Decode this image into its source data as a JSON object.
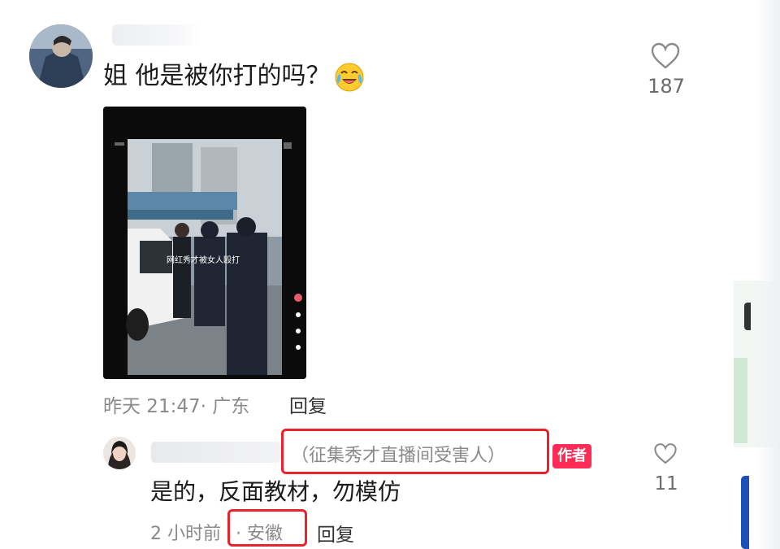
{
  "top_comment": {
    "text": "姐 他是被你打的吗？",
    "emoji": "crying-laughing-face-icon",
    "likes": "187",
    "time": "昨天 21:47",
    "location": "· 广东",
    "reply_label": "回复",
    "video_overlay_text": "网红秀才被女人殴打"
  },
  "reply_comment": {
    "name_note": "（征集秀才直播间受害人）",
    "author_badge": "作者",
    "text": "是的，反面教材，勿模仿",
    "likes": "11",
    "time": "2 小时前",
    "location": "· 安徽",
    "reply_label": "回复"
  },
  "colors": {
    "annotation_red": "#e8232b",
    "author_badge_bg": "#fe2c55",
    "meta_gray": "#8a8a8a"
  }
}
